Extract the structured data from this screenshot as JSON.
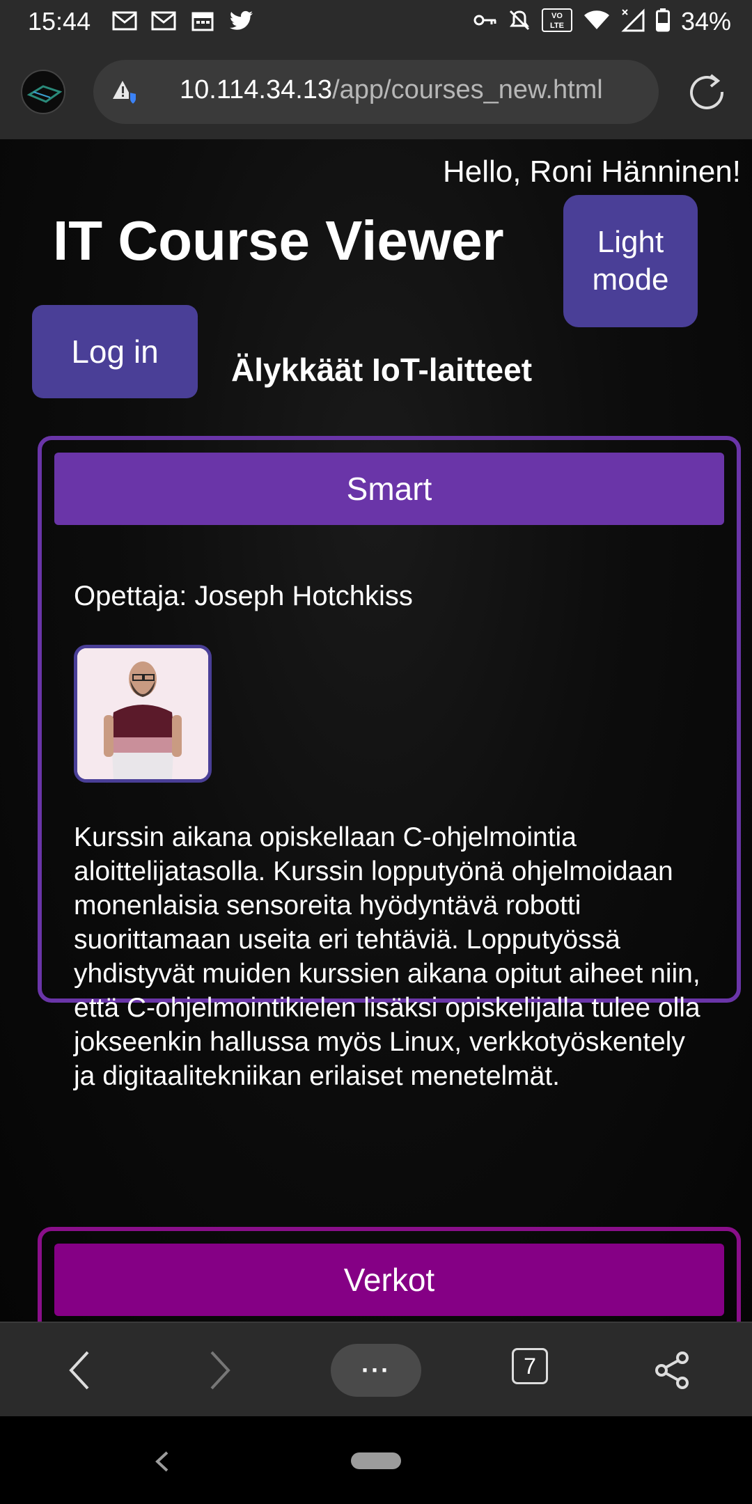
{
  "status_bar": {
    "time": "15:44",
    "battery": "34%",
    "left_icons": [
      "gmail-icon",
      "gmail-icon",
      "calendar-icon",
      "twitter-icon"
    ],
    "right_icons": [
      "vpn-key-icon",
      "mute-icon",
      "volte-icon",
      "wifi-icon",
      "signal-icon",
      "battery-icon"
    ]
  },
  "browser": {
    "url_host": "10.114.34.13",
    "url_path": "/app/courses_new.html",
    "tab_count": "7",
    "menu_label": "···"
  },
  "page": {
    "greeting": "Hello, Roni Hänninen!",
    "title": "IT Course Viewer",
    "theme_button_line1": "Light",
    "theme_button_line2": "mode",
    "login_button": "Log in",
    "course_heading": "Älykkäät IoT-laitteet"
  },
  "courses": [
    {
      "header": "Smart",
      "teacher": "Opettaja: Joseph Hotchkiss",
      "description": "Kurssin aikana opiskellaan C-ohjelmointia aloittelijatasolla. Kurssin lopputyönä ohjelmoidaan monenlaisia sensoreita hyödyntävä robotti suorittamaan useita eri tehtäviä. Lopputyössä yhdistyvät muiden kurssien aikana opitut aiheet niin, että C-ohjelmointikielen lisäksi opiskelijalla tulee olla jokseenkin hallussa myös Linux, verkkotyöskentely ja digitaalitekniikan erilaiset menetelmät.",
      "accent": "#6a35a8"
    },
    {
      "header": "Verkot",
      "accent": "#850085"
    }
  ],
  "colors": {
    "button": "#4a3f97",
    "bar": "#2b2b2b"
  }
}
